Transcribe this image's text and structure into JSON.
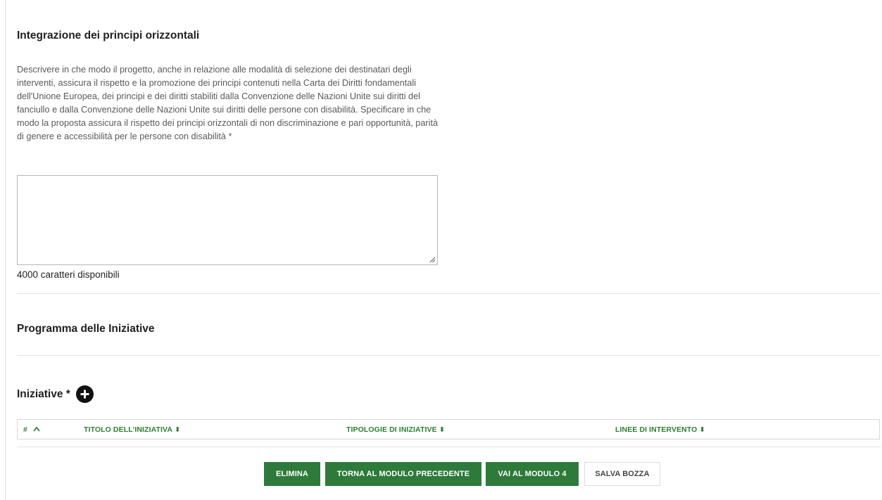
{
  "section_integration": {
    "title": "Integrazione dei principi orizzontali",
    "description": "Descrivere in che modo il progetto, anche in relazione alle modalità di selezione dei destinatari degli interventi, assicura il rispetto e la promozione dei principi contenuti nella Carta dei Diritti fondamentali dell'Unione Europea, dei principi e dei diritti stabiliti dalla Convenzione delle Nazioni Unite sui diritti del fanciullo e dalla Convenzione delle Nazioni Unite sui diritti delle persone con disabilità. Specificare in che modo la proposta assicura il rispetto dei principi orizzontali di non discriminazione e pari opportunità, parità di genere e accessibilità per le persone con disabilità *",
    "textarea_value": "",
    "chars_available": "4000 caratteri disponibili"
  },
  "section_program": {
    "title": "Programma delle Iniziative"
  },
  "iniziative": {
    "title": "Iniziative *",
    "add_icon": "plus-circle-icon",
    "columns": [
      {
        "label": "#",
        "sort_icon": "chevron-up-icon"
      },
      {
        "label": "TITOLO DELL'INIZIATIVA",
        "sort_icon": "sort-icon"
      },
      {
        "label": "TIPOLOGIE DI INIZIATIVE",
        "sort_icon": "sort-icon"
      },
      {
        "label": "LINEE DI INTERVENTO",
        "sort_icon": "sort-icon"
      }
    ]
  },
  "actions": {
    "delete": "ELIMINA",
    "back": "TORNA AL MODULO PRECEDENTE",
    "next": "VAI AL MODULO 4",
    "save_draft": "SALVA BOZZA"
  },
  "colors": {
    "accent_green": "#2d7a3a",
    "header_green": "#2e7d32"
  }
}
